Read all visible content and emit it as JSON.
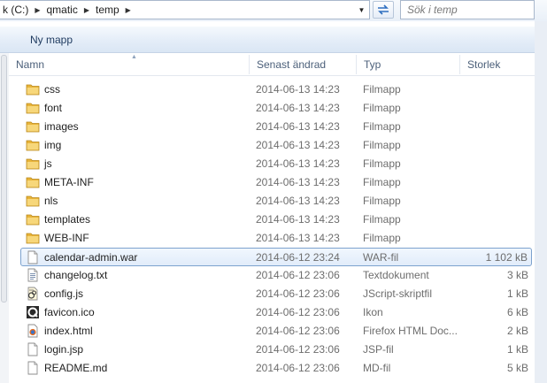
{
  "address": {
    "crumbs": [
      "k (C:)",
      "qmatic",
      "temp"
    ]
  },
  "search": {
    "placeholder": "Sök i temp"
  },
  "toolbar": {
    "new_folder": "Ny mapp"
  },
  "columns": {
    "name": "Namn",
    "date": "Senast ändrad",
    "type": "Typ",
    "size": "Storlek"
  },
  "files": [
    {
      "icon": "folder-icon",
      "name": "css",
      "date": "2014-06-13 14:23",
      "type": "Filmapp",
      "size": ""
    },
    {
      "icon": "folder-icon",
      "name": "font",
      "date": "2014-06-13 14:23",
      "type": "Filmapp",
      "size": ""
    },
    {
      "icon": "folder-icon",
      "name": "images",
      "date": "2014-06-13 14:23",
      "type": "Filmapp",
      "size": ""
    },
    {
      "icon": "folder-icon",
      "name": "img",
      "date": "2014-06-13 14:23",
      "type": "Filmapp",
      "size": ""
    },
    {
      "icon": "folder-icon",
      "name": "js",
      "date": "2014-06-13 14:23",
      "type": "Filmapp",
      "size": ""
    },
    {
      "icon": "folder-icon",
      "name": "META-INF",
      "date": "2014-06-13 14:23",
      "type": "Filmapp",
      "size": ""
    },
    {
      "icon": "folder-icon",
      "name": "nls",
      "date": "2014-06-13 14:23",
      "type": "Filmapp",
      "size": ""
    },
    {
      "icon": "folder-icon",
      "name": "templates",
      "date": "2014-06-13 14:23",
      "type": "Filmapp",
      "size": ""
    },
    {
      "icon": "folder-icon",
      "name": "WEB-INF",
      "date": "2014-06-13 14:23",
      "type": "Filmapp",
      "size": ""
    },
    {
      "icon": "blank-file-icon",
      "name": "calendar-admin.war",
      "date": "2014-06-12 23:24",
      "type": "WAR-fil",
      "size": "1 102 kB",
      "selected": true
    },
    {
      "icon": "text-file-icon",
      "name": "changelog.txt",
      "date": "2014-06-12 23:06",
      "type": "Textdokument",
      "size": "3 kB"
    },
    {
      "icon": "script-file-icon",
      "name": "config.js",
      "date": "2014-06-12 23:06",
      "type": "JScript-skriptfil",
      "size": "1 kB"
    },
    {
      "icon": "favicon-file-icon",
      "name": "favicon.ico",
      "date": "2014-06-12 23:06",
      "type": "Ikon",
      "size": "6 kB"
    },
    {
      "icon": "html-file-icon",
      "name": "index.html",
      "date": "2014-06-12 23:06",
      "type": "Firefox HTML Doc...",
      "size": "2 kB"
    },
    {
      "icon": "blank-file-icon",
      "name": "login.jsp",
      "date": "2014-06-12 23:06",
      "type": "JSP-fil",
      "size": "1 kB"
    },
    {
      "icon": "blank-file-icon",
      "name": "README.md",
      "date": "2014-06-12 23:06",
      "type": "MD-fil",
      "size": "5 kB"
    }
  ]
}
